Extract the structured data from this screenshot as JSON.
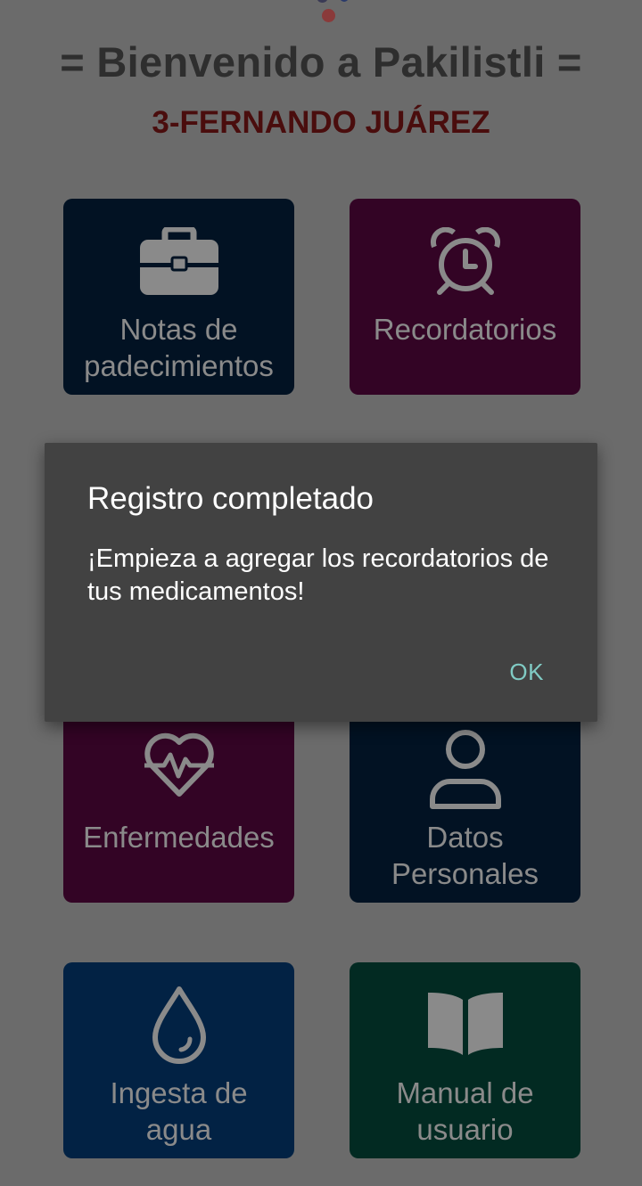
{
  "header": {
    "title": "= Bienvenido a Pakilistli =",
    "username": "3-FERNANDO JUÁREZ"
  },
  "tiles": [
    {
      "label": "Notas de\npadecimientos",
      "icon": "briefcase-icon",
      "color": "#021223"
    },
    {
      "label": "Recordatorios",
      "icon": "alarm-clock-icon",
      "color": "#330425"
    },
    {
      "label": "Enfermedades",
      "icon": "heart-pulse-icon",
      "color": "#330425"
    },
    {
      "label": "Datos\nPersonales",
      "icon": "person-icon",
      "color": "#021223"
    },
    {
      "label": "Ingesta de\nagua",
      "icon": "water-drop-icon",
      "color": "#022244"
    },
    {
      "label": "Manual de\nusuario",
      "icon": "open-book-icon",
      "color": "#022a22"
    }
  ],
  "dialog": {
    "title": "Registro completado",
    "message": "¡Empieza a agregar los recordatorios de tus medicamentos!",
    "ok_label": "OK"
  },
  "colors": {
    "scrim": "#6b6b6b",
    "dialog_bg": "#424242",
    "accent": "#80cbc4",
    "username": "#4a0d0d"
  }
}
